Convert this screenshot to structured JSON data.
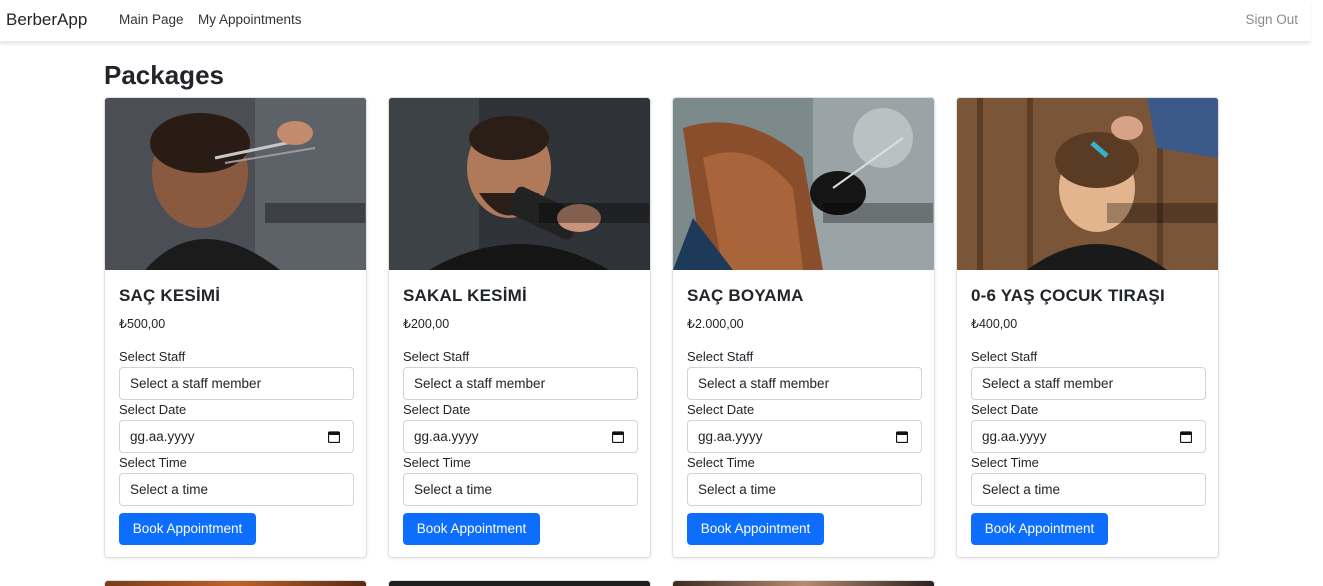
{
  "navbar": {
    "brand": "BerberApp",
    "main_page": "Main Page",
    "my_appointments": "My Appointments",
    "sign_out": "Sign Out"
  },
  "page": {
    "title": "Packages"
  },
  "form_labels": {
    "select_staff": "Select Staff",
    "staff_placeholder": "Select a staff member",
    "select_date": "Select Date",
    "date_placeholder": "gg.aa.yyyy",
    "select_time": "Select Time",
    "time_placeholder": "Select a time",
    "book_button": "Book Appointment"
  },
  "packages": [
    {
      "name": "SAÇ KESİMİ",
      "price": "₺500,00"
    },
    {
      "name": "SAKAL KESİMİ",
      "price": "₺200,00"
    },
    {
      "name": "SAÇ BOYAMA",
      "price": "₺2.000,00"
    },
    {
      "name": "0-6 YAŞ ÇOCUK TIRAŞI",
      "price": "₺400,00"
    }
  ],
  "colors": {
    "primary": "#0d6efd"
  }
}
